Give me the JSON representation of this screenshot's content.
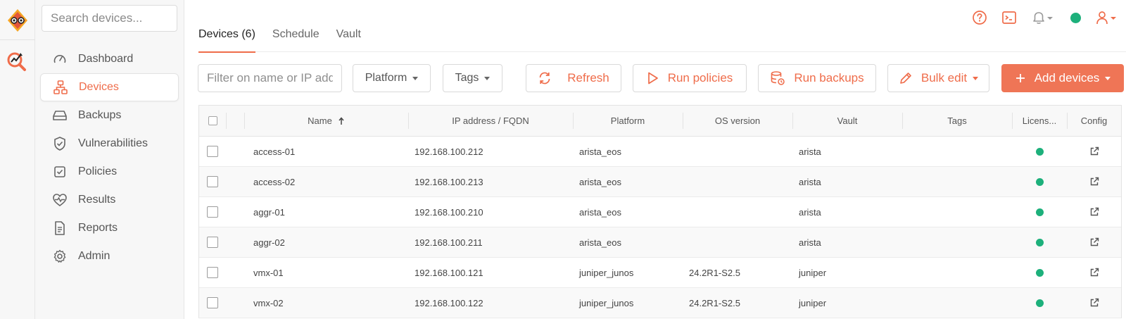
{
  "search": {
    "placeholder": "Search devices..."
  },
  "sidebar": {
    "items": [
      {
        "label": "Dashboard",
        "icon": "gauge-icon"
      },
      {
        "label": "Devices",
        "icon": "network-icon",
        "active": true
      },
      {
        "label": "Backups",
        "icon": "hard-drive-icon"
      },
      {
        "label": "Vulnerabilities",
        "icon": "shield-check-icon"
      },
      {
        "label": "Policies",
        "icon": "checkbox-icon"
      },
      {
        "label": "Results",
        "icon": "heart-pulse-icon"
      },
      {
        "label": "Reports",
        "icon": "document-icon"
      },
      {
        "label": "Admin",
        "icon": "gear-icon"
      }
    ]
  },
  "tabs": [
    {
      "label": "Devices (6)",
      "active": true
    },
    {
      "label": "Schedule"
    },
    {
      "label": "Vault"
    }
  ],
  "toolbar": {
    "filter_placeholder": "Filter on name or IP address",
    "platform_label": "Platform",
    "tags_label": "Tags",
    "refresh_label": "Refresh",
    "run_policies_label": "Run policies",
    "run_backups_label": "Run backups",
    "bulk_edit_label": "Bulk edit",
    "add_devices_label": "Add devices"
  },
  "table": {
    "columns": [
      "Name",
      "IP address / FQDN",
      "Platform",
      "OS version",
      "Vault",
      "Tags",
      "Licens...",
      "Config"
    ],
    "rows": [
      {
        "name": "access-01",
        "ip": "192.168.100.212",
        "platform": "arista_eos",
        "os": "",
        "vault": "arista",
        "tags": ""
      },
      {
        "name": "access-02",
        "ip": "192.168.100.213",
        "platform": "arista_eos",
        "os": "",
        "vault": "arista",
        "tags": ""
      },
      {
        "name": "aggr-01",
        "ip": "192.168.100.210",
        "platform": "arista_eos",
        "os": "",
        "vault": "arista",
        "tags": ""
      },
      {
        "name": "aggr-02",
        "ip": "192.168.100.211",
        "platform": "arista_eos",
        "os": "",
        "vault": "arista",
        "tags": ""
      },
      {
        "name": "vmx-01",
        "ip": "192.168.100.121",
        "platform": "juniper_junos",
        "os": "24.2R1-S2.5",
        "vault": "juniper",
        "tags": ""
      },
      {
        "name": "vmx-02",
        "ip": "192.168.100.122",
        "platform": "juniper_junos",
        "os": "24.2R1-S2.5",
        "vault": "juniper",
        "tags": ""
      }
    ]
  },
  "colors": {
    "accent": "#ef6c4a",
    "status_ok": "#1db07b"
  }
}
